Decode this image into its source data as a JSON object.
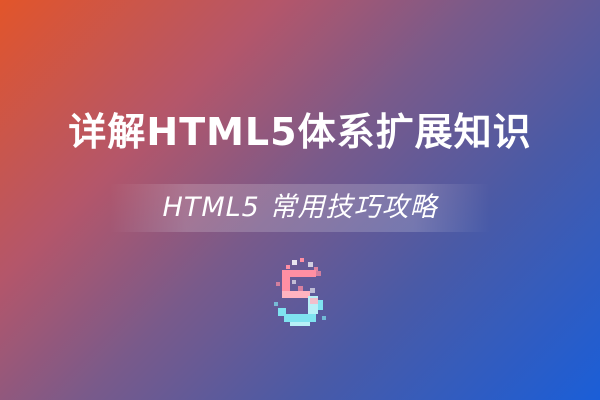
{
  "banner": {
    "title": "详解HTML5体系扩展知识",
    "subtitle": "HTML5 常用技巧攻略",
    "logo": {
      "icon": "html5-pixel-five-icon",
      "colors": {
        "pink": "#ff8fa3",
        "cyan": "#7fe3f0",
        "white": "#ffffff"
      }
    },
    "background_colors": [
      "#e2552a",
      "#7a5a8a",
      "#1a5ed8"
    ]
  }
}
